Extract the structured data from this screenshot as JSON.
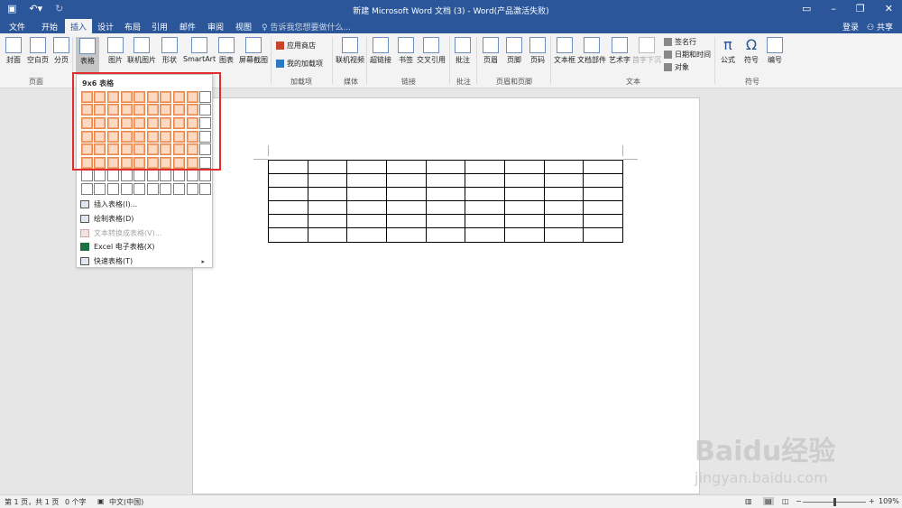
{
  "title_bar": {
    "quick_access": [
      "save-icon",
      "undo-icon",
      "redo-icon"
    ],
    "title": "新建 Microsoft Word 文档 (3) - Word(产品激活失败)",
    "window_buttons": [
      "ribbon-display-icon",
      "minimize-icon",
      "restore-icon",
      "close-icon"
    ]
  },
  "tabs": [
    "文件",
    "开始",
    "插入",
    "设计",
    "布局",
    "引用",
    "邮件",
    "审阅",
    "视图"
  ],
  "active_tab": "插入",
  "tell_me": "告诉我您想要做什么...",
  "login": "登录",
  "share": "共享",
  "ribbon": {
    "buttons": [
      "封面",
      "空白页",
      "分页",
      "表格",
      "图片",
      "联机图片",
      "形状",
      "SmartArt",
      "图表",
      "屏幕截图",
      "联机视频",
      "超链接",
      "书签",
      "交叉引用",
      "批注",
      "页眉",
      "页脚",
      "页码",
      "文本框",
      "文档部件",
      "艺术字",
      "首字下沉",
      "公式",
      "符号",
      "编号"
    ],
    "small_buttons": [
      "应用商店",
      "我的加载项",
      "签名行",
      "日期和时间",
      "对象"
    ],
    "groups": [
      "页面",
      "加载项",
      "媒体",
      "链接",
      "批注",
      "页眉和页脚",
      "文本",
      "符号"
    ]
  },
  "table_dropdown": {
    "title": "9x6 表格",
    "grid_cols": 10,
    "grid_rows": 8,
    "selected_cols": 9,
    "selected_rows": 6,
    "menu": [
      {
        "label": "插入表格(I)...",
        "disabled": false
      },
      {
        "label": "绘制表格(D)",
        "disabled": false
      },
      {
        "label": "文本转换成表格(V)...",
        "disabled": true
      },
      {
        "label": "Excel 电子表格(X)",
        "disabled": false
      },
      {
        "label": "快速表格(T)",
        "disabled": false
      }
    ]
  },
  "document_table": {
    "cols": 9,
    "rows": 6
  },
  "status": {
    "page": "第 1 页，共 1 页",
    "words": "0 个字",
    "language": "中文(中国)",
    "zoom": "109%",
    "zoom_minus": "−",
    "zoom_plus": "+"
  },
  "watermark": {
    "brand": "Baidu经验",
    "url": "jingyan.baidu.com"
  },
  "colors": {
    "brand": "#2b579a",
    "highlight": "#e02d2d",
    "grid_selected": "#e8864b"
  }
}
